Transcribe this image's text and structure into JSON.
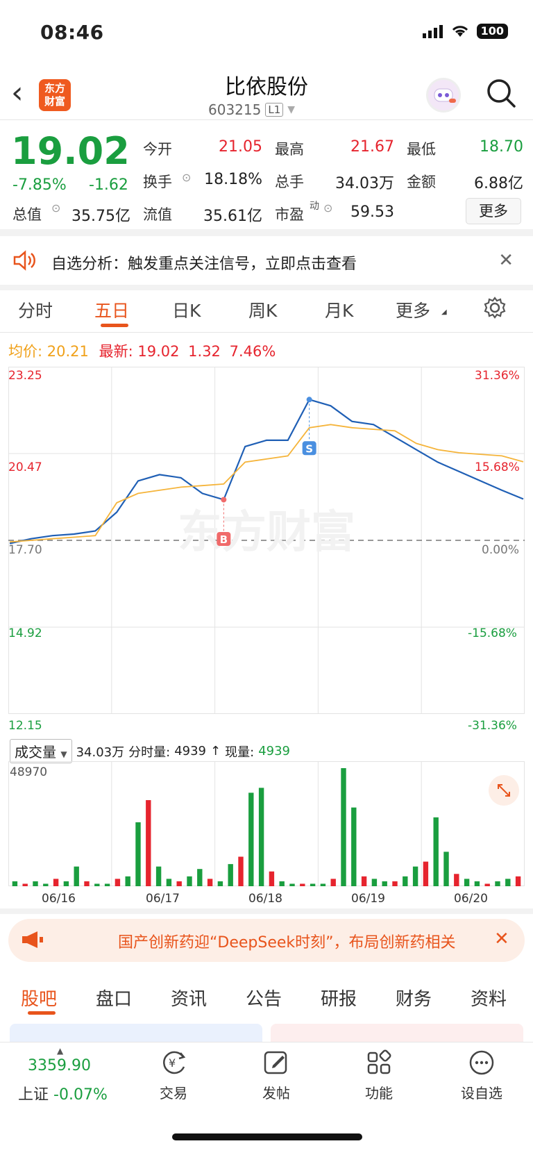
{
  "status": {
    "time": "08:46",
    "battery": "100"
  },
  "header": {
    "title": "比依股份",
    "code": "603215",
    "level_badge": "L1",
    "logo_line1": "东方",
    "logo_line2": "财富"
  },
  "quote": {
    "price": "19.02",
    "change_pct": "-7.85%",
    "change": "-1.62",
    "open_label": "今开",
    "open": "21.05",
    "high_label": "最高",
    "high": "21.67",
    "low_label": "最低",
    "low": "18.70",
    "turnover_label": "换手",
    "turnover": "18.18%",
    "volume_label": "总手",
    "volume": "34.03万",
    "amount_label": "金额",
    "amount": "6.88亿",
    "mktcap_label": "总值",
    "mktcap": "35.75亿",
    "float_label": "流值",
    "float": "35.61亿",
    "pe_label": "市盈",
    "pe_sup": "动",
    "pe": "59.53",
    "more": "更多"
  },
  "alert": {
    "text": "自选分析：触发重点关注信号，立即点击查看"
  },
  "tabs": [
    "分时",
    "五日",
    "日K",
    "周K",
    "月K",
    "更多"
  ],
  "active_tab": "五日",
  "chart_header": {
    "avg_label": "均价:",
    "avg": "20.21",
    "latest_label": "最新:",
    "latest": "19.02",
    "chg": "1.32",
    "chg_pct": "7.46%"
  },
  "chart_data": {
    "type": "line",
    "y_labels_left": [
      "23.25",
      "20.47",
      "17.70",
      "14.92",
      "12.15"
    ],
    "y_labels_right": [
      "31.36%",
      "15.68%",
      "0.00%",
      "-15.68%",
      "-31.36%"
    ],
    "ylim": [
      12.15,
      23.25
    ],
    "categories": [
      "06/16",
      "06/17",
      "06/18",
      "06/19",
      "06/20"
    ],
    "series": [
      {
        "values": [
          17.6,
          17.75,
          17.85,
          17.9,
          18.0,
          18.6,
          19.6,
          19.8,
          19.7,
          19.2,
          19.0,
          20.7,
          20.9,
          20.9,
          22.2,
          22.0,
          21.5,
          21.4,
          21.0,
          20.6,
          20.2,
          19.9,
          19.6,
          19.3,
          19.02
        ]
      },
      {
        "values": [
          17.65,
          17.7,
          17.75,
          17.8,
          17.85,
          18.9,
          19.2,
          19.3,
          19.4,
          19.45,
          19.5,
          20.2,
          20.3,
          20.4,
          21.3,
          21.4,
          21.3,
          21.25,
          21.2,
          20.8,
          20.6,
          20.5,
          20.45,
          20.4,
          20.21
        ]
      }
    ],
    "markers": [
      {
        "label": "B"
      },
      {
        "label": "S"
      }
    ]
  },
  "volume": {
    "select_label": "成交量",
    "total": "34.03万",
    "tick_label": "分时量:",
    "tick": "4939",
    "arrow": "↑",
    "now_label": "现量:",
    "now": "4939",
    "max_label": "48970",
    "bars": [
      2,
      1,
      2,
      1,
      3,
      2,
      8,
      2,
      1,
      1,
      3,
      4,
      26,
      35,
      8,
      3,
      2,
      4,
      7,
      3,
      2,
      9,
      12,
      38,
      40,
      6,
      2,
      1,
      1,
      1,
      1,
      3,
      48,
      32,
      4,
      3,
      2,
      2,
      4,
      8,
      10,
      28,
      14,
      5,
      3,
      2,
      1,
      2,
      3,
      4
    ]
  },
  "watermark": "东方财富",
  "ad": {
    "text": "国产创新药迎“DeepSeek时刻”，布局创新药相关"
  },
  "bottom_tabs": [
    "股吧",
    "盘口",
    "资讯",
    "公告",
    "研报",
    "财务",
    "资料"
  ],
  "nav": {
    "index_value": "3359.90",
    "index_name": "上证",
    "index_chg": "-0.07%",
    "trade": "交易",
    "post": "发帖",
    "function": "功能",
    "watch": "设自选"
  }
}
